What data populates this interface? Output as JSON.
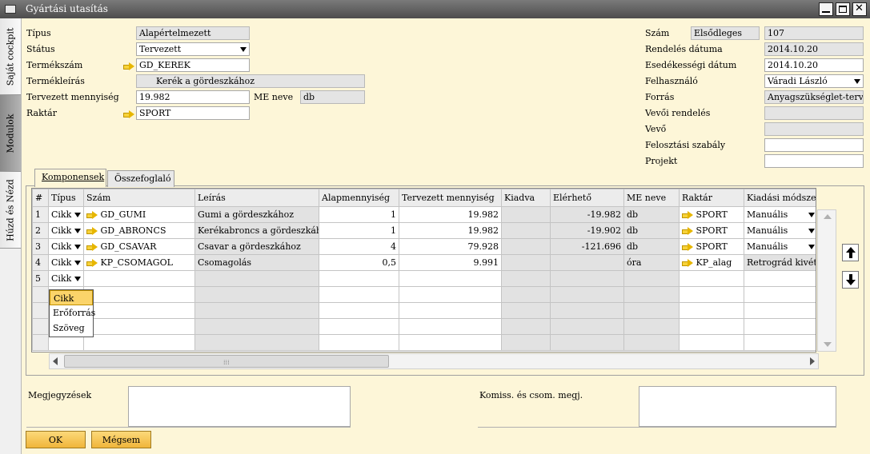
{
  "window": {
    "title": "Gyártási utasítás"
  },
  "sidebar": {
    "tabs": [
      "Saját cockpit",
      "Modulok",
      "Húzd és Nézd"
    ]
  },
  "left_form": {
    "tipus": {
      "label": "Típus",
      "value": "Alapértelmezett"
    },
    "status": {
      "label": "Státus",
      "value": "Tervezett"
    },
    "termekszam": {
      "label": "Termékszám",
      "value": "GD_KEREK"
    },
    "termekleiras": {
      "label": "Termékleírás",
      "value": "Kerék a gördeszkához"
    },
    "tervezett_mennyiseg": {
      "label": "Tervezett mennyiség",
      "value": "19.982"
    },
    "me_neve": {
      "label": "ME neve",
      "value": "db"
    },
    "raktar": {
      "label": "Raktár",
      "value": "SPORT"
    }
  },
  "right_form": {
    "szam": {
      "label": "Szám",
      "series": "Elsődleges",
      "value": "107"
    },
    "rendeles_datuma": {
      "label": "Rendelés dátuma",
      "value": "2014.10.20"
    },
    "esedekessegi_datum": {
      "label": "Esedékességi dátum",
      "value": "2014.10.20"
    },
    "felhasznalo": {
      "label": "Felhasználó",
      "value": "Váradi László"
    },
    "forras": {
      "label": "Forrás",
      "value": "Anyagszükséglet-tervezé"
    },
    "vevoi_rendeles": {
      "label": "Vevői rendelés",
      "value": ""
    },
    "vevo": {
      "label": "Vevő",
      "value": ""
    },
    "felosztasi_szabaly": {
      "label": "Felosztási szabály",
      "value": ""
    },
    "projekt": {
      "label": "Projekt",
      "value": ""
    }
  },
  "tabs": [
    {
      "label": "Komponensek",
      "active": true
    },
    {
      "label": "Összefoglaló",
      "active": false
    }
  ],
  "grid": {
    "columns": [
      "#",
      "Típus",
      "Szám",
      "Leírás",
      "Alapmennyiség",
      "Tervezett mennyiség",
      "Kiadva",
      "Elérhető",
      "ME neve",
      "Raktár",
      "Kiadási módszer"
    ],
    "rows": [
      {
        "n": "1",
        "tipus": "Cikk",
        "szam": "GD_GUMI",
        "leiras": "Gumi a gördeszkához",
        "alap": "1",
        "terv": "19.982",
        "kiadva": "",
        "elerheto": "-19.982",
        "me": "db",
        "raktar": "SPORT",
        "modszer": "Manuális"
      },
      {
        "n": "2",
        "tipus": "Cikk",
        "szam": "GD_ABRONCS",
        "leiras": "Kerékabroncs a gördeszkához",
        "alap": "1",
        "terv": "19.982",
        "kiadva": "",
        "elerheto": "-19.902",
        "me": "db",
        "raktar": "SPORT",
        "modszer": "Manuális"
      },
      {
        "n": "3",
        "tipus": "Cikk",
        "szam": "GD_CSAVAR",
        "leiras": "Csavar a gördeszkához",
        "alap": "4",
        "terv": "79.928",
        "kiadva": "",
        "elerheto": "-121.696",
        "me": "db",
        "raktar": "SPORT",
        "modszer": "Manuális"
      },
      {
        "n": "4",
        "tipus": "Cikk",
        "szam": "KP_CSOMAGOL",
        "leiras": "Csomagolás",
        "alap": "0,5",
        "terv": "9.991",
        "kiadva": "",
        "elerheto": "",
        "me": "óra",
        "raktar": "KP_alag",
        "modszer": "Retrográd kivét"
      },
      {
        "n": "5",
        "tipus": "Cikk",
        "szam": "",
        "leiras": "",
        "alap": "",
        "terv": "",
        "kiadva": "",
        "elerheto": "",
        "me": "",
        "raktar": "",
        "modszer": ""
      }
    ],
    "dropdown_options": [
      "Cikk",
      "Erőforrás",
      "Szöveg"
    ]
  },
  "notes": {
    "megjegyzesek_label": "Megjegyzések",
    "komiss_label": "Komiss. és csom. megj."
  },
  "buttons": {
    "ok": "OK",
    "cancel": "Mégsem"
  }
}
